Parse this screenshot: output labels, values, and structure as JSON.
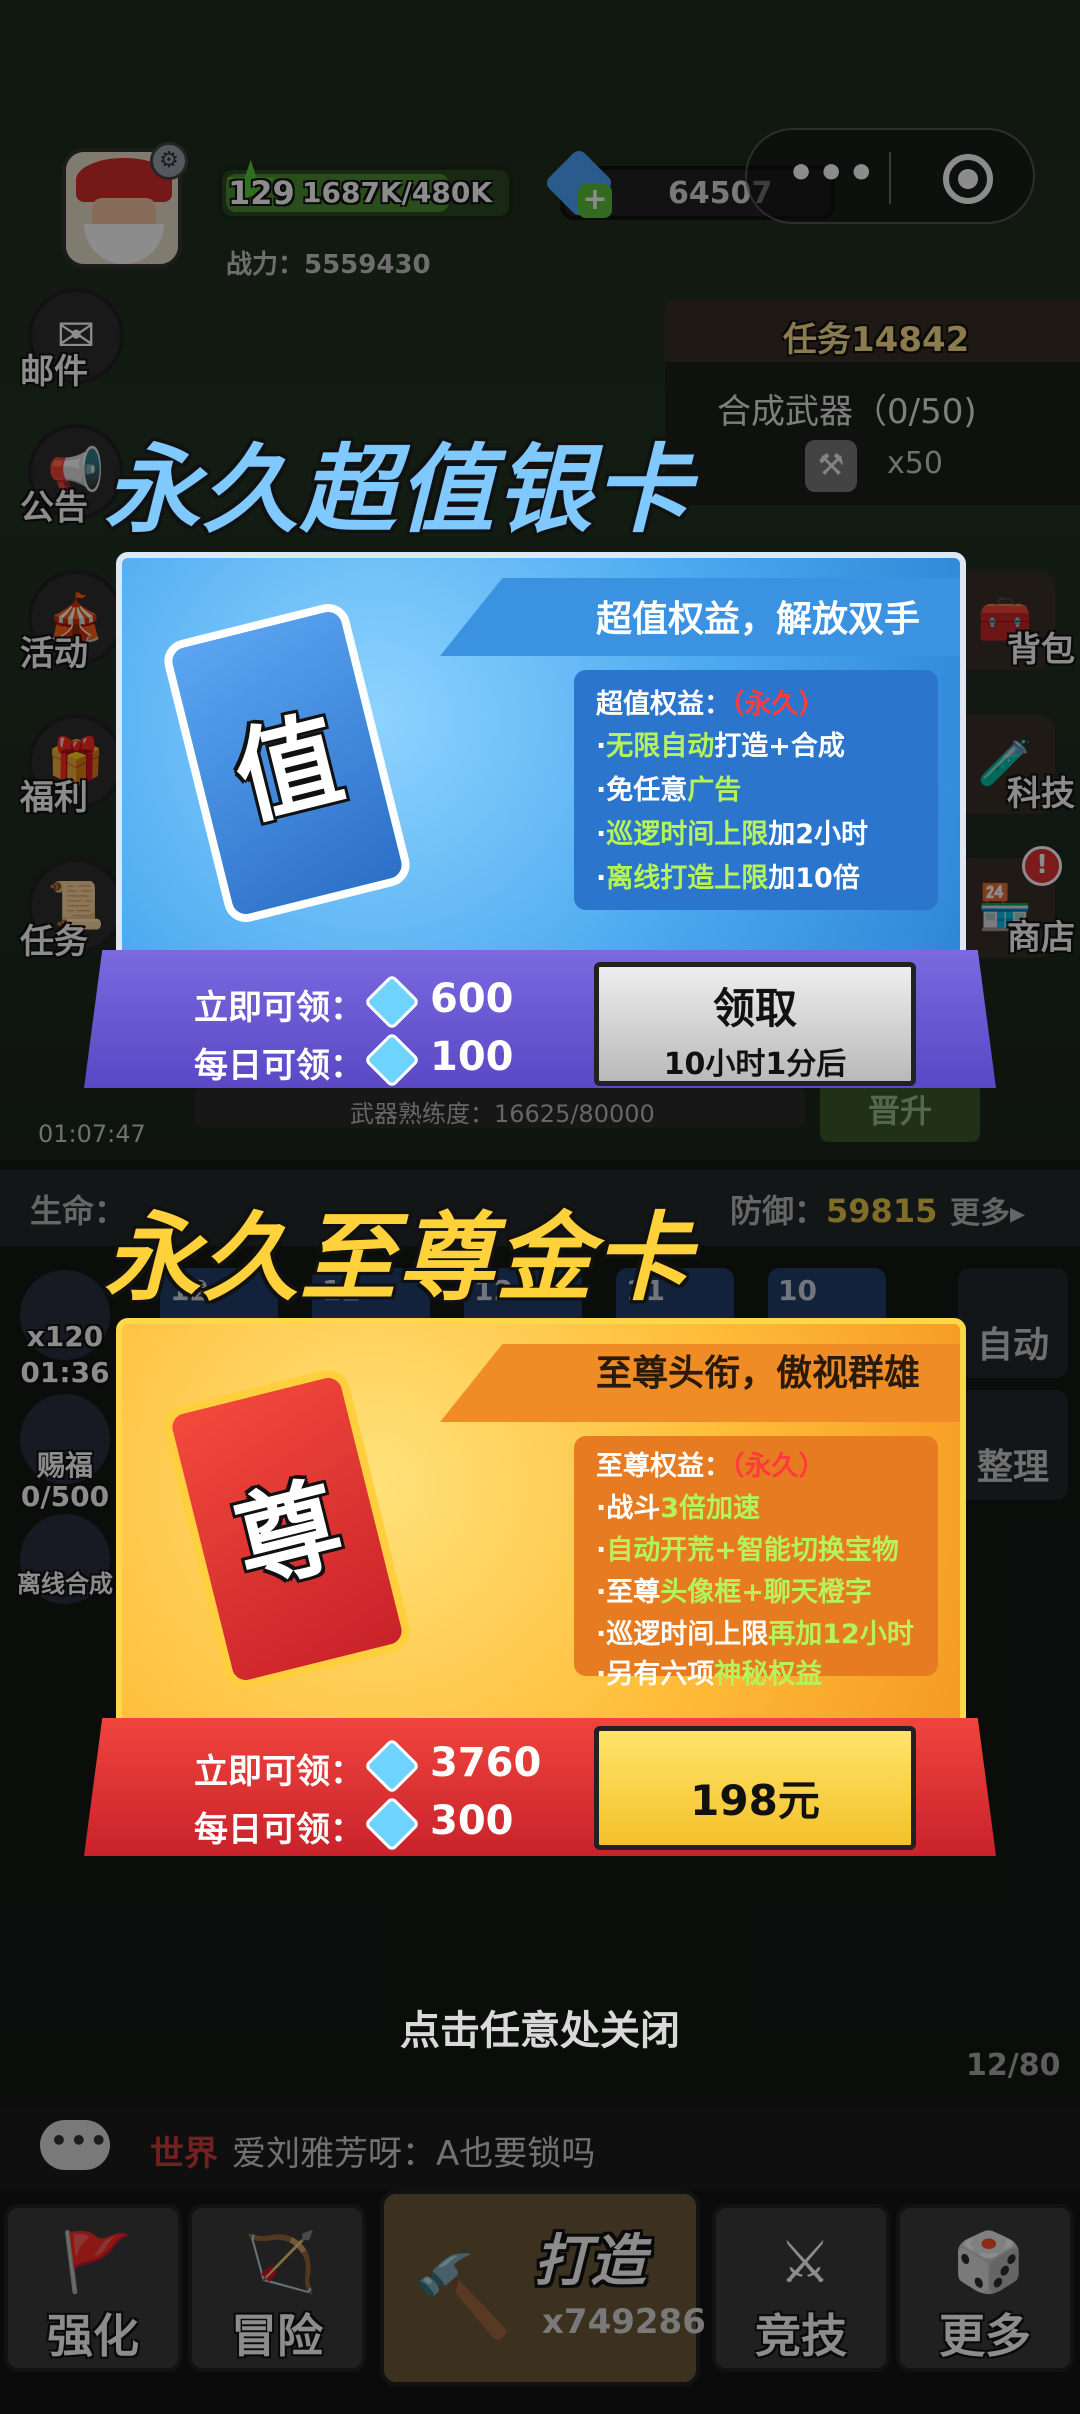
{
  "hud": {
    "level": "129",
    "level_progress": 0.8,
    "xp": "1687K/480K",
    "power": "战力：5559430",
    "gems": "64507",
    "menu_dots": "•••"
  },
  "task": {
    "title": "任务14842",
    "desc": "合成武器（0/50)",
    "count": "x50"
  },
  "side_left": [
    "邮件",
    "公告",
    "活动",
    "福利",
    "任务"
  ],
  "side_right": [
    "背包",
    "科技",
    "商店"
  ],
  "game": {
    "timer": "01:07:47",
    "heat": "武器熟练度：16625/80000",
    "upgrade": "晋升",
    "life_label": "生命：",
    "def_label": "防御：",
    "def_value": "59815",
    "more": "更多▸",
    "slots": [
      "12",
      "12",
      "12",
      "11",
      "10"
    ],
    "mini_left": [
      {
        "t1": "x120",
        "t2": "01:36"
      },
      {
        "t1": "赐福",
        "t2": "0/500"
      },
      {
        "t1": "离线合成",
        "t2": ""
      }
    ],
    "right_tools": [
      "自动",
      "整理"
    ],
    "close_hint": "点击任意处关闭",
    "page_count": "12/80"
  },
  "chat": {
    "channel": "世界",
    "message": "爱刘雅芳呀：A也要锁吗"
  },
  "nav": {
    "items": [
      "强化",
      "冒险",
      "竞技",
      "更多"
    ],
    "forge_label": "打造",
    "forge_count": "x749286"
  },
  "silver_card": {
    "title": "永久超值银卡",
    "banner": "超值权益，解放双手",
    "ticket_char": "值",
    "perks_head": "超值权益：",
    "perks_perm": "（永久）",
    "perks": [
      {
        "pre": "·",
        "hl": "无限自动",
        "post": "打造+合成"
      },
      {
        "pre": "·免任意",
        "hl": "广告",
        "post": ""
      },
      {
        "pre": "·",
        "hl": "巡逻时间上限",
        "post": "加2小时"
      },
      {
        "pre": "·",
        "hl": "离线打造上限",
        "post": "加10倍"
      }
    ],
    "instant_label": "立即可领：",
    "instant_value": "600",
    "daily_label": "每日可领：",
    "daily_value": "100",
    "button_label": "领取",
    "button_sub": "10小时1分后"
  },
  "gold_card": {
    "title": "永久至尊金卡",
    "banner": "至尊头衔，傲视群雄",
    "ticket_char": "尊",
    "perks_head": "至尊权益：",
    "perks_perm": "（永久）",
    "perks": [
      {
        "pre": "·战斗",
        "hl": "3倍加速",
        "post": ""
      },
      {
        "pre": "·",
        "hl": "自动开荒+智能切换宝物",
        "post": ""
      },
      {
        "pre": "·至尊",
        "hl": "头像框+聊天橙字",
        "post": ""
      },
      {
        "pre": "·巡逻时间上限",
        "hl": "再加12小时",
        "post": ""
      },
      {
        "pre": "·另有六项",
        "hl": "神秘权益",
        "post": ""
      }
    ],
    "instant_label": "立即可领：",
    "instant_value": "3760",
    "daily_label": "每日可领：",
    "daily_value": "300",
    "button_label": "198元"
  }
}
